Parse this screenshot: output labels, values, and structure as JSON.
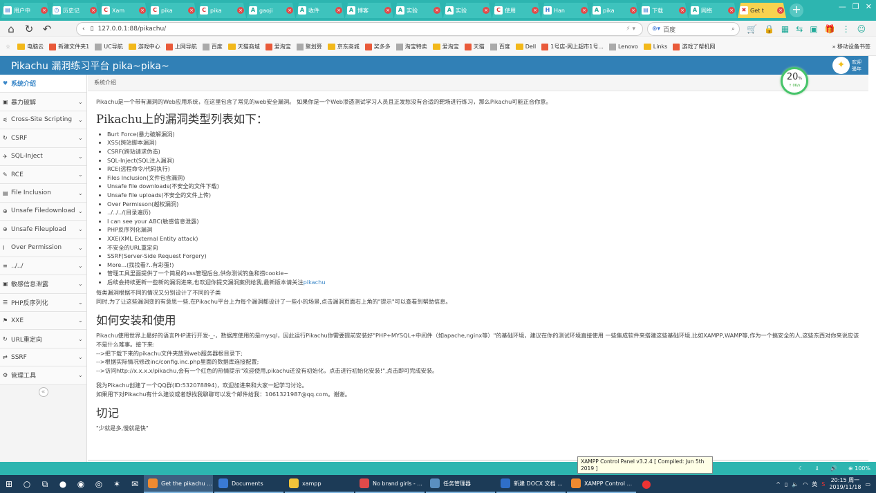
{
  "browser": {
    "tabs": [
      {
        "label": "用户中",
        "icon": "page"
      },
      {
        "label": "历史记",
        "icon": "clock"
      },
      {
        "label": "Xam",
        "icon": "c"
      },
      {
        "label": "pika",
        "icon": "c"
      },
      {
        "label": "pika",
        "icon": "c"
      },
      {
        "label": "gaoji",
        "icon": "leaf"
      },
      {
        "label": "收件",
        "icon": "leaf"
      },
      {
        "label": "博客",
        "icon": "leaf"
      },
      {
        "label": "实验",
        "icon": "leaf"
      },
      {
        "label": "实验",
        "icon": "leaf"
      },
      {
        "label": "使用",
        "icon": "c"
      },
      {
        "label": "Han",
        "icon": "h"
      },
      {
        "label": "pika",
        "icon": "leaf"
      },
      {
        "label": "下载",
        "icon": "page"
      },
      {
        "label": "网络",
        "icon": "leaf"
      },
      {
        "label": "Get t",
        "icon": "x",
        "active": true
      }
    ],
    "new_tab": "+",
    "url": "127.0.0.1:88/pikachu/",
    "search_engine": "百度",
    "bookmarks": [
      "电脑云",
      "新建文件夹1",
      "UC导航",
      "游戏中心",
      "上网导航",
      "百度",
      "天猫商城",
      "爱淘宝",
      "聚划算",
      "京东商城",
      "奖多多",
      "淘宝特卖",
      "爱淘宝",
      "天猫",
      "百度",
      "Dell",
      "1号店-网上超市1号...",
      "Lenovo",
      "Links",
      "游戏了帮机网"
    ],
    "bookmarks_right": "» 移动设备书签"
  },
  "header": {
    "title": "Pikachu 漏洞练习平台 pika~pika~",
    "user_line1": "欢迎",
    "user_line2": "骚年"
  },
  "gauge": {
    "percent": "20",
    "unit": "%",
    "speed": "↑ 0K/s"
  },
  "sidebar": {
    "items": [
      {
        "label": "系统介绍",
        "icon": "♥",
        "active": true
      },
      {
        "label": "暴力破解",
        "icon": "▣"
      },
      {
        "label": "Cross-Site Scripting",
        "icon": "⚟"
      },
      {
        "label": "CSRF",
        "icon": "↻"
      },
      {
        "label": "SQL-Inject",
        "icon": "✈"
      },
      {
        "label": "RCE",
        "icon": "✎"
      },
      {
        "label": "File Inclusion",
        "icon": "▤"
      },
      {
        "label": "Unsafe Filedownload",
        "icon": "⊕"
      },
      {
        "label": "Unsafe Fileupload",
        "icon": "⊕"
      },
      {
        "label": "Over Permission",
        "icon": "I"
      },
      {
        "label": "../../",
        "icon": "≡"
      },
      {
        "label": "敏感信息泄露",
        "icon": "▣"
      },
      {
        "label": "PHP反序列化",
        "icon": "☰"
      },
      {
        "label": "XXE",
        "icon": "⚑"
      },
      {
        "label": "URL重定向",
        "icon": "↻"
      },
      {
        "label": "SSRF",
        "icon": "⇄"
      },
      {
        "label": "管理工具",
        "icon": "⚙"
      }
    ],
    "collapse": "«"
  },
  "breadcrumb": "系统介绍",
  "content": {
    "intro": "Pikachu是一个带有漏洞的Web应用系统，在这里包含了常见的web安全漏洞。 如果你是一个Web渗透测试学习人员且正发愁没有合适的靶场进行练习，那么Pikachu可能正合你意。",
    "h_types": "Pikachu上的漏洞类型列表如下：",
    "types": [
      "Burt Force(暴力破解漏洞)",
      "XSS(跨站脚本漏洞)",
      "CSRF(跨站请求伪造)",
      "SQL-Inject(SQL注入漏洞)",
      "RCE(远程命令/代码执行)",
      "Files Inclusion(文件包含漏洞)",
      "Unsafe file downloads(不安全的文件下载)",
      "Unsafe file uploads(不安全的文件上传)",
      "Over Permisson(越权漏洞)",
      "../../../(目录遍历)",
      "I can see your ABC(敏感信息泄露)",
      "PHP反序列化漏洞",
      "XXE(XML External Entity attack)",
      "不安全的URL重定向",
      "SSRF(Server-Side Request Forgery)",
      "More...(找找看?..有彩蛋!)",
      "管理工具里面提供了一个简易的xss管理后台,供你测试钓鱼和捞cookie~"
    ],
    "last_type_text": "后续会持续更新一些新的漏洞进来,也欢迎你提交漏洞案例给我,最新版本请关注",
    "last_type_link": "pikachu",
    "note1": "每类漏洞根据不同的情况又分别设计了不同的子类",
    "note2": "同时,为了让这些漏洞变的有意思一些,在Pikachu平台上为每个漏洞都设计了一些小的场景,点击漏洞页面右上角的\"提示\"可以查看到帮助信息。",
    "h_install": "如何安装和使用",
    "install1": "Pikachu使用世界上最好的语言PHP进行开发-_-，数据库使用的是mysql，因此运行Pikachu你需要提前安装好\"PHP+MYSQL+中间件（如apache,nginx等）\"的基础环境，建议在你的测试环境直接使用 一些集成软件来搭建这些基础环境,比如XAMPP,WAMP等,作为一个搞安全的人,这些东西对你来说应该不是什么难事。接下来:",
    "install2": "-->把下载下来的pikachu文件夹放到web服务器根目录下;",
    "install3": "-->根据实际情况修改inc/config.inc.php里面的数据库连接配置;",
    "install4": "-->访问http://x.x.x.x/pikachu,会有一个红色的热情提示\"欢迎使用,pikachu还没有初始化，点击进行初始化安装!\",点击即可完成安装。",
    "qq1": "我为Pikachu创建了一个QQ群(ID:532078894)，欢迎加进来和大家一起学习讨论。",
    "qq2": "如果用下对Pikachu有什么建议或者想找我聊聊可以发个邮件给我：1061321987@qq.com。谢谢。",
    "h_remember": "切记",
    "remember": "\"少就是多,慢就是快\""
  },
  "statusbar": {
    "zoom": "100%"
  },
  "tooltip": {
    "line1": "XAMPP Control Panel v3.2.4   [ Compiled: Jun 5th",
    "line2": "2019 ]"
  },
  "taskbar": {
    "apps": [
      {
        "label": "Get the pikachu ...",
        "color": "#f08a30",
        "active": true
      },
      {
        "label": "Documents",
        "color": "#3a7bd5"
      },
      {
        "label": "xampp",
        "color": "#f2c43a"
      },
      {
        "label": "No brand girls - ...",
        "color": "#e04a4a"
      },
      {
        "label": "任务管理器",
        "color": "#5a8fc0"
      },
      {
        "label": "新建 DOCX 文档 ...",
        "color": "#2f6fc8"
      },
      {
        "label": "XAMPP Control ...",
        "color": "#f08a30"
      }
    ],
    "time": "20:15 周一",
    "date": "2019/11/18",
    "ime": "英"
  }
}
